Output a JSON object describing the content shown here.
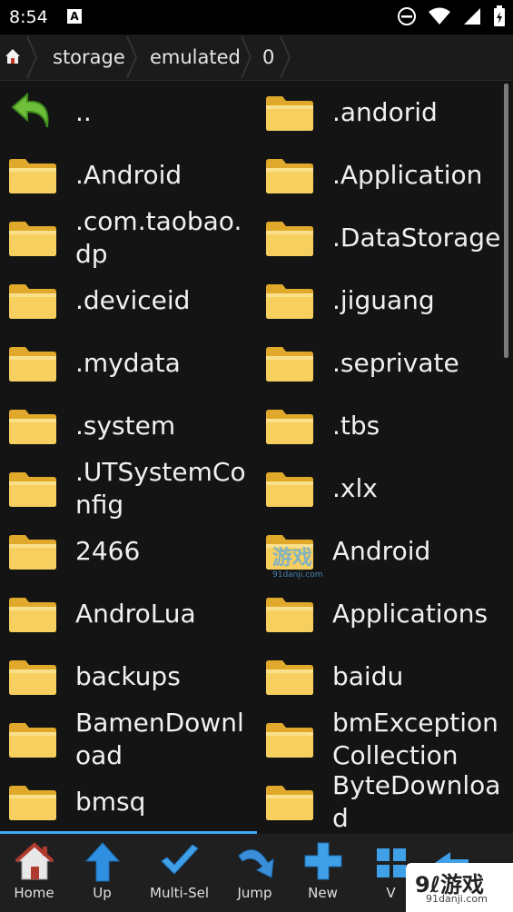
{
  "status": {
    "time": "8:54",
    "a_badge": "A"
  },
  "path": {
    "crumbs": [
      "storage",
      "emulated",
      "0"
    ]
  },
  "files": {
    "items": [
      {
        "label": "..",
        "icon": "up-arrow-icon"
      },
      {
        "label": ".andorid",
        "icon": "folder-icon"
      },
      {
        "label": ".Android",
        "icon": "folder-icon"
      },
      {
        "label": ".Application",
        "icon": "folder-icon"
      },
      {
        "label": ".com.taobao.\ndp",
        "icon": "folder-icon"
      },
      {
        "label": ".DataStorage",
        "icon": "folder-icon"
      },
      {
        "label": ".deviceid",
        "icon": "folder-icon"
      },
      {
        "label": ".jiguang",
        "icon": "folder-icon"
      },
      {
        "label": ".mydata",
        "icon": "folder-icon"
      },
      {
        "label": ".seprivate",
        "icon": "folder-icon"
      },
      {
        "label": ".system",
        "icon": "folder-icon"
      },
      {
        "label": ".tbs",
        "icon": "folder-icon"
      },
      {
        "label": ".UTSystemCo\nnfig",
        "icon": "folder-icon"
      },
      {
        "label": ".xlx",
        "icon": "folder-icon"
      },
      {
        "label": "2466",
        "icon": "folder-icon"
      },
      {
        "label": "Android",
        "icon": "folder-icon"
      },
      {
        "label": "AndroLua",
        "icon": "folder-icon"
      },
      {
        "label": "Applications",
        "icon": "folder-icon"
      },
      {
        "label": "backups",
        "icon": "folder-icon"
      },
      {
        "label": "baidu",
        "icon": "folder-icon"
      },
      {
        "label": "BamenDownl\noad",
        "icon": "folder-icon"
      },
      {
        "label": "bmException\nCollection",
        "icon": "folder-icon"
      },
      {
        "label": "bmsq",
        "icon": "folder-icon"
      },
      {
        "label": "ByteDownloa\nd",
        "icon": "folder-icon"
      }
    ]
  },
  "toolbar": {
    "home": "Home",
    "up": "Up",
    "multisel": "Multi-Sel",
    "jump": "Jump",
    "new": "New",
    "view": "V"
  },
  "watermark": {
    "logo": "9ℓ游戏",
    "domain": "91danji.com",
    "mid": "游戏",
    "mid_domain": "91danji.com"
  },
  "colors": {
    "folder": "#f2c94c",
    "accent": "#3fa9f5",
    "background": "#141414"
  }
}
